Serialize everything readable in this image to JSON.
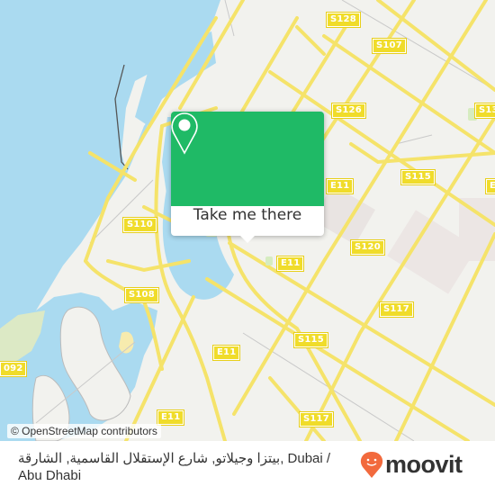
{
  "map": {
    "colors": {
      "water": "#aadaf0",
      "land": "#f2f2ee",
      "road_major": "#f5e36a",
      "road_minor": "#c9c9c9",
      "park": "#d6ecc0",
      "shield": "#f0dc2a"
    },
    "road_labels": [
      {
        "id": "s128",
        "text": "S128"
      },
      {
        "id": "s107",
        "text": "S107"
      },
      {
        "id": "s126",
        "text": "S126"
      },
      {
        "id": "s13x",
        "text": "S13"
      },
      {
        "id": "e11-a",
        "text": "E11"
      },
      {
        "id": "s115-a",
        "text": "S115"
      },
      {
        "id": "e1x",
        "text": "E1"
      },
      {
        "id": "s110",
        "text": "S110"
      },
      {
        "id": "s120",
        "text": "S120"
      },
      {
        "id": "e11-b",
        "text": "E11"
      },
      {
        "id": "s108",
        "text": "S108"
      },
      {
        "id": "s117-a",
        "text": "S117"
      },
      {
        "id": "s115-b",
        "text": "S115"
      },
      {
        "id": "e11-c",
        "text": "E11"
      },
      {
        "id": "d92",
        "text": "092"
      },
      {
        "id": "e11-d",
        "text": "E11"
      },
      {
        "id": "s117-b",
        "text": "S117"
      }
    ],
    "attribution": "© OpenStreetMap contributors"
  },
  "popup": {
    "icon": "map-pin-icon",
    "button_label": "Take me there"
  },
  "footer": {
    "place_name": "بيتزا وجيلاتو, شارع الإستقلال القاسمية, الشارقة, Dubai / Abu Dhabi",
    "logo_text": "moovit",
    "logo_color": "#f26a3d"
  }
}
